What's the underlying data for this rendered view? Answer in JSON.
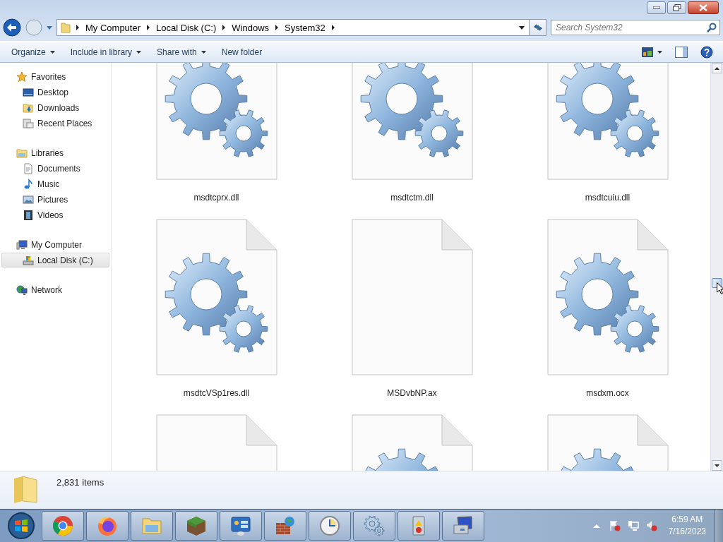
{
  "address": {
    "parts": [
      "My Computer",
      "Local Disk (C:)",
      "Windows",
      "System32"
    ]
  },
  "search": {
    "placeholder": "Search System32"
  },
  "toolbar": {
    "buttons": [
      "Organize",
      "Include in library",
      "Share with",
      "New folder"
    ]
  },
  "sidebar": {
    "groups": [
      {
        "label": "Favorites",
        "kind": "star",
        "selected": false,
        "children": [
          {
            "label": "Desktop",
            "kind": "desktop",
            "selected": false
          },
          {
            "label": "Downloads",
            "kind": "downloads",
            "selected": false
          },
          {
            "label": "Recent Places",
            "kind": "recent",
            "selected": false
          }
        ]
      },
      {
        "label": "Libraries",
        "kind": "library",
        "selected": false,
        "children": [
          {
            "label": "Documents",
            "kind": "documents",
            "selected": false
          },
          {
            "label": "Music",
            "kind": "music",
            "selected": false
          },
          {
            "label": "Pictures",
            "kind": "pictures",
            "selected": false
          },
          {
            "label": "Videos",
            "kind": "videos",
            "selected": false
          }
        ]
      },
      {
        "label": "My Computer",
        "kind": "computer",
        "selected": false,
        "children": [
          {
            "label": "Local Disk (C:)",
            "kind": "disk",
            "selected": true
          }
        ]
      },
      {
        "label": "Network",
        "kind": "network",
        "selected": false
      }
    ]
  },
  "files": [
    {
      "name": "msdtcprx.dll",
      "kind": "gear"
    },
    {
      "name": "msdtctm.dll",
      "kind": "gear"
    },
    {
      "name": "msdtcuiu.dll",
      "kind": "gear"
    },
    {
      "name": "msdtcVSp1res.dll",
      "kind": "gear"
    },
    {
      "name": "MSDvbNP.ax",
      "kind": "blank"
    },
    {
      "name": "msdxm.ocx",
      "kind": "gear"
    },
    {
      "kind": "blank"
    },
    {
      "kind": "gear"
    },
    {
      "kind": "gear"
    }
  ],
  "status_bar": {
    "count": "2,831 items"
  },
  "taskbar": {
    "time": "6:59 AM",
    "date": "7/16/2023"
  }
}
